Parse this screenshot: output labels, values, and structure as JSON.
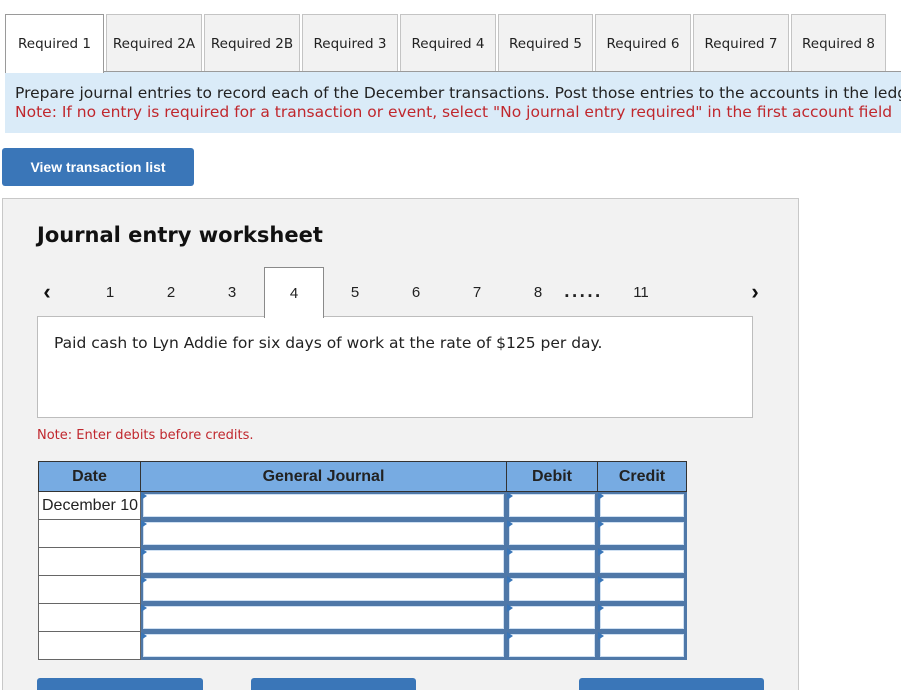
{
  "tabs": [
    {
      "label": "Required 1",
      "active": true
    },
    {
      "label": "Required 2A",
      "active": false
    },
    {
      "label": "Required 2B",
      "active": false
    },
    {
      "label": "Required 3",
      "active": false
    },
    {
      "label": "Required 4",
      "active": false
    },
    {
      "label": "Required 5",
      "active": false
    },
    {
      "label": "Required 6",
      "active": false
    },
    {
      "label": "Required 7",
      "active": false
    },
    {
      "label": "Required 8",
      "active": false
    }
  ],
  "instructions": {
    "main": "Prepare journal entries to record each of the December transactions. Post those entries to the accounts in the ledger",
    "note": "Note: If no entry is required for a transaction or event, select \"No journal entry required\" in the first account field"
  },
  "view_transaction_button": "View transaction list",
  "worksheet": {
    "title": "Journal entry worksheet",
    "pager": {
      "prev_icon": "chevron-left-icon",
      "next_icon": "chevron-right-icon",
      "pages": [
        "1",
        "2",
        "3",
        "4",
        "5",
        "6",
        "7",
        "8",
        "11"
      ],
      "ellipsis": ".....",
      "active_page": "4"
    },
    "description": "Paid cash to Lyn Addie for six days of work at the rate of $125 per day.",
    "note": "Note: Enter debits before credits.",
    "table": {
      "headers": {
        "date": "Date",
        "general_journal": "General Journal",
        "debit": "Debit",
        "credit": "Credit"
      },
      "rows": [
        {
          "date": "December 10",
          "account": "",
          "debit": "",
          "credit": ""
        },
        {
          "date": "",
          "account": "",
          "debit": "",
          "credit": ""
        },
        {
          "date": "",
          "account": "",
          "debit": "",
          "credit": ""
        },
        {
          "date": "",
          "account": "",
          "debit": "",
          "credit": ""
        },
        {
          "date": "",
          "account": "",
          "debit": "",
          "credit": ""
        },
        {
          "date": "",
          "account": "",
          "debit": "",
          "credit": ""
        }
      ]
    }
  },
  "colors": {
    "accent_button": "#3a76b8",
    "table_header": "#77abe2",
    "instruction_bg": "#daebf8",
    "note_red": "#c0272d"
  }
}
